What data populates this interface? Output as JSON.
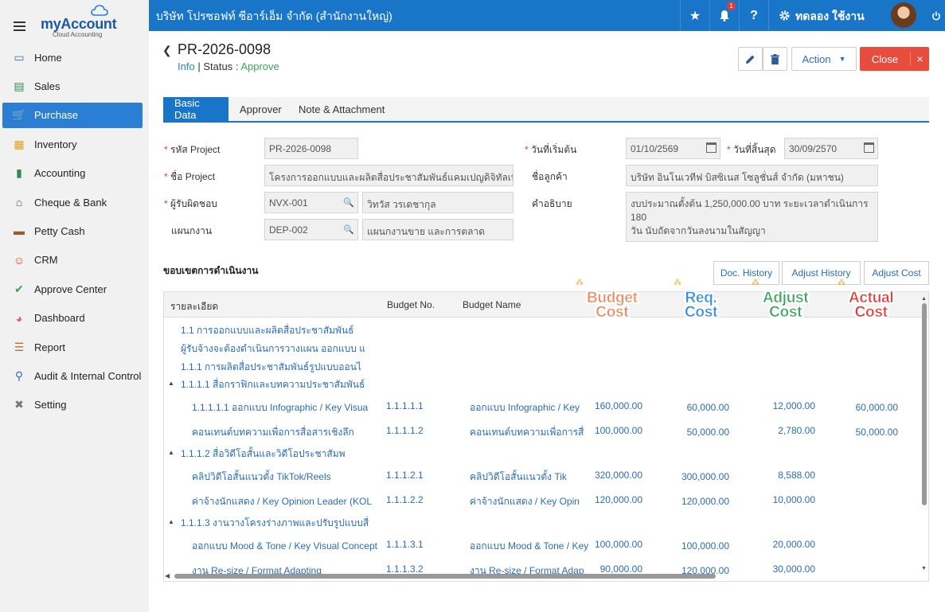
{
  "sidebar": {
    "logo_title": "myAccount",
    "logo_sub": "Cloud Accounting",
    "items": [
      {
        "label": "Home",
        "icon": "home-icon",
        "active": false
      },
      {
        "label": "Sales",
        "icon": "cash-icon",
        "active": false
      },
      {
        "label": "Purchase",
        "icon": "cart-icon",
        "active": true
      },
      {
        "label": "Inventory",
        "icon": "box-icon",
        "active": false
      },
      {
        "label": "Accounting",
        "icon": "book-icon",
        "active": false
      },
      {
        "label": "Cheque & Bank",
        "icon": "bank-icon",
        "active": false
      },
      {
        "label": "Petty Cash",
        "icon": "wallet-icon",
        "active": false
      },
      {
        "label": "CRM",
        "icon": "crm-icon",
        "active": false
      },
      {
        "label": "Approve Center",
        "icon": "check-icon",
        "active": false
      },
      {
        "label": "Dashboard",
        "icon": "pie-icon",
        "active": false
      },
      {
        "label": "Report",
        "icon": "report-icon",
        "active": false
      },
      {
        "label": "Audit & Internal Control",
        "icon": "magnifier-icon",
        "active": false
      },
      {
        "label": "Setting",
        "icon": "tools-icon",
        "active": false
      }
    ]
  },
  "header": {
    "company": "บริษัท โปรซอฟท์ ซีอาร์เอ็ม จำกัด (สำนักงานใหญ่)",
    "notif_count": "1",
    "help": "?",
    "user": "ทดลอง ใช้งาน"
  },
  "doc": {
    "number": "PR-2026-0098",
    "info_link": "Info",
    "separator": "|",
    "status_label": "Status",
    "status_colon": ":",
    "status_value": "Approve",
    "action_label": "Action",
    "close_label": "Close"
  },
  "tabs": [
    "Basic Data",
    "Approver",
    "Note & Attachment"
  ],
  "form": {
    "project_code_label": "รหัส Project",
    "project_code": "PR-2026-0098",
    "project_name_label": "ชื่อ Project",
    "project_name": "โครงการออกแบบและผลิตสื่อประชาสัมพันธ์แคมเปญดิจิทัลเพื่อก",
    "owner_label": "ผู้รับผิดชอบ",
    "owner_code": "NVX-001",
    "owner_name": "วิทวัส วรเดชากุล",
    "dept_label": "แผนกงาน",
    "dept_code": "DEP-002",
    "dept_name": "แผนกงานขาย และการตลาด",
    "start_label": "วันที่เริ่มต้น",
    "start_date": "01/10/2569",
    "end_label": "วันที่สิ้นสุด",
    "end_date": "30/09/2570",
    "customer_label": "ชื่อลูกค้า",
    "customer": "บริษัท อินโนเวทีฟ บิสซิเนส โซลูชั่นส์ จำกัด (มหาชน)",
    "desc_label": "คำอธิบาย",
    "desc_line1": "งบประมาณตั้งต้น 1,250,000.00 บาท ระยะเวลาดำเนินการ 180",
    "desc_line2": "วัน นับถัดจากวันลงนามในสัญญา"
  },
  "scope": {
    "title": "ขอบเขตการดำเนินงาน",
    "doc_history": "Doc. History",
    "adjust_history": "Adjust History",
    "adjust_cost": "Adjust Cost"
  },
  "table": {
    "headers": {
      "detail": "รายละเอียด",
      "budget_no": "Budget No.",
      "budget_name": "Budget Name"
    },
    "big_headers": [
      {
        "line1": "Budget",
        "line2": "Cost",
        "color": "#f08a5d"
      },
      {
        "line1": "Req.",
        "line2": "Cost",
        "color": "#2f8fe0"
      },
      {
        "line1": "Adjust",
        "line2": "Cost",
        "color": "#3aa55a"
      },
      {
        "line1": "Actual",
        "line2": "Cost",
        "color": "#e53935"
      }
    ],
    "group_rows": [
      "1.1 การออกแบบและผลิตสื่อประชาสัมพันธ์",
      "ผู้รับจ้างจะต้องดำเนินการวางแผน ออกแบบ แ",
      "1.1.1 การผลิตสื่อประชาสัมพันธ์รูปแบบออนไ"
    ],
    "sections": [
      {
        "title": "1.1.1.1 สื่อกราฟิกและบทความประชาสัมพันธ์",
        "rows": [
          {
            "detail": "1.1.1.1.1 ออกแบบ Infographic / Key Visua",
            "no": "1.1.1.1.1",
            "name": "ออกแบบ Infographic / Key",
            "budget": "160,000.00",
            "req": "60,000.00",
            "adjust": "12,000.00",
            "actual": "60,000.00"
          },
          {
            "detail": "คอนเทนต์บทความเพื่อการสื่อสารเชิงลึก",
            "no": "1.1.1.1.2",
            "name": "คอนเทนต์บทความเพื่อการสื่",
            "budget": "100,000.00",
            "req": "50,000.00",
            "adjust": "2,780.00",
            "actual": "50,000.00"
          }
        ]
      },
      {
        "title": "1.1.1.2 สื่อวิดีโอสั้นและวิดีโอประชาสัมพ",
        "rows": [
          {
            "detail": "คลิปวิดีโอสั้นแนวตั้ง TikTok/Reels",
            "no": "1.1.1.2.1",
            "name": "คลิปวิดีโอสั้นแนวตั้ง Tik",
            "budget": "320,000.00",
            "req": "300,000.00",
            "adjust": "8,588.00",
            "actual": ""
          },
          {
            "detail": "ค่าจ้างนักแสดง / Key Opinion Leader (KOL",
            "no": "1.1.1.2.2",
            "name": "ค่าจ้างนักแสดง / Key Opin",
            "budget": "120,000.00",
            "req": "120,000.00",
            "adjust": "10,000.00",
            "actual": ""
          }
        ]
      },
      {
        "title": "1.1.1.3 งานวางโครงร่างภาพและปรับรูปแบบสื่",
        "rows": [
          {
            "detail": "ออกแบบ Mood & Tone / Key Visual Concept",
            "no": "1.1.1.3.1",
            "name": "ออกแบบ Mood & Tone / Key",
            "budget": "100,000.00",
            "req": "100,000.00",
            "adjust": "20,000.00",
            "actual": ""
          },
          {
            "detail": "งาน Re-size / Format Adapting",
            "no": "1.1.1.3.2",
            "name": "งาน Re-size / Format Adap",
            "budget": "90,000.00",
            "req": "120,000.00",
            "adjust": "30,000.00",
            "actual": ""
          }
        ]
      }
    ]
  }
}
